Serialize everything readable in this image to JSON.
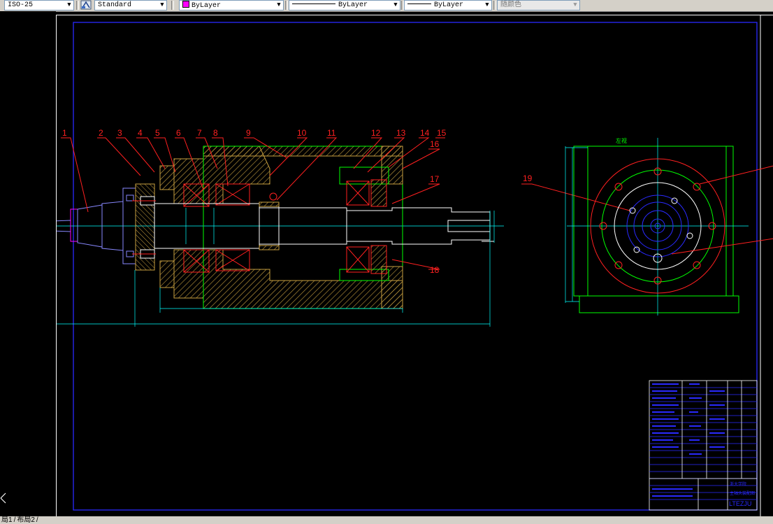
{
  "toolbar": {
    "dimstyle": "ISO-25",
    "textstyle": "Standard",
    "color": "ByLayer",
    "color_swatch": "#ff00ff",
    "linetype": "ByLayer",
    "lineweight": "ByLayer",
    "plotstyle": "随颜色"
  },
  "part_numbers": [
    "1",
    "2",
    "3",
    "4",
    "5",
    "6",
    "7",
    "8",
    "9",
    "10",
    "11",
    "12",
    "13",
    "14",
    "15",
    "16",
    "17",
    "18",
    "19"
  ],
  "side_view_label": "左视",
  "title_block": {
    "drawing_code": "LTEZJU",
    "unit": "浙大学院",
    "drawing_name": "主轴头装配图"
  },
  "layout_tabs": [
    "局1",
    "布局2"
  ],
  "colors": {
    "background": "#000000",
    "frame": "#2a2aff",
    "hatch": "#c8a040",
    "leader": "#ff2020",
    "outline": "#00ff00",
    "centerline": "#00ffff",
    "white": "#ffffff",
    "magenta": "#ff00ff"
  }
}
